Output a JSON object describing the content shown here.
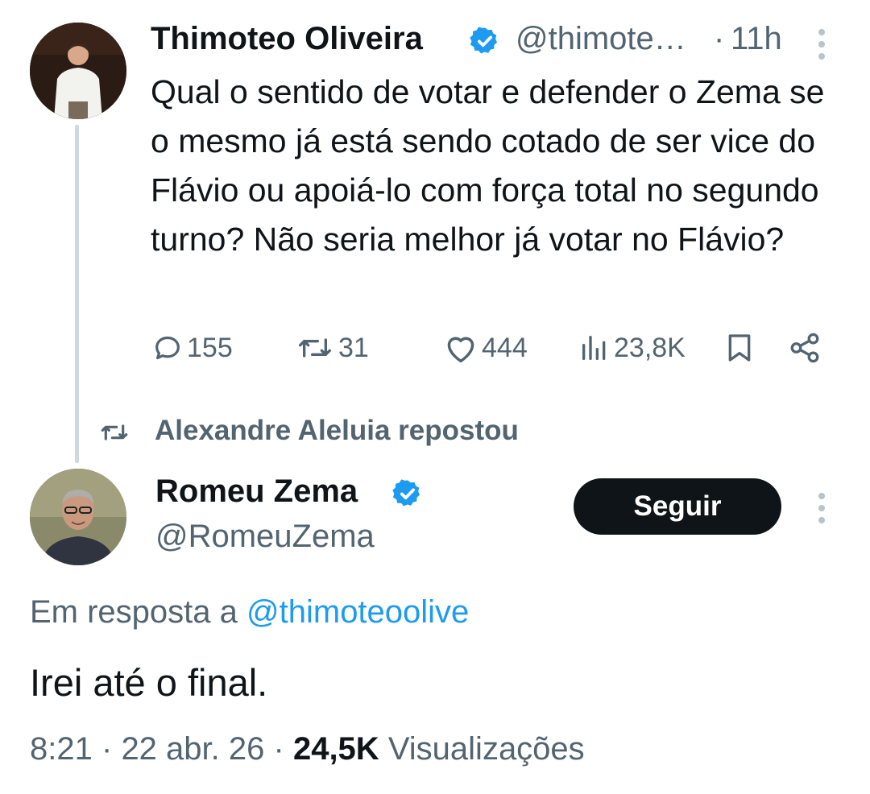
{
  "tweet1": {
    "author_name": "Thimoteo Oliveira",
    "handle": "@thimote…",
    "separator": "·",
    "time": "11h",
    "text": "Qual o sentido de votar e defender o Zema se o mesmo já está sendo cotado de ser vice do Flávio ou apoiá-lo com força total no segundo turno? Não seria melhor já votar no Flávio?",
    "stats": {
      "replies": "155",
      "reposts": "31",
      "likes": "444",
      "views": "23,8K"
    }
  },
  "repost_notice": "Alexandre Aleluia repostou",
  "tweet2": {
    "author_name": "Romeu Zema",
    "handle": "@RomeuZema",
    "follow_label": "Seguir",
    "reply_prefix": "Em resposta a",
    "reply_to": "@thimoteoolive",
    "text": "Irei até o final.",
    "time": "8:21",
    "dot_a": "·",
    "date": "22 abr. 26",
    "dot_b": "·",
    "views_count": "24,5K",
    "views_label": "Visualizações"
  },
  "colors": {
    "verified": "#1d9bf0",
    "link": "#1d9bf0",
    "muted": "#536471",
    "text": "#0f1419",
    "button_bg": "#0f1419"
  },
  "icons": [
    "verified-badge-icon",
    "more-options-icon",
    "reply-icon",
    "repost-icon",
    "like-icon",
    "views-icon",
    "bookmark-icon",
    "share-icon"
  ]
}
